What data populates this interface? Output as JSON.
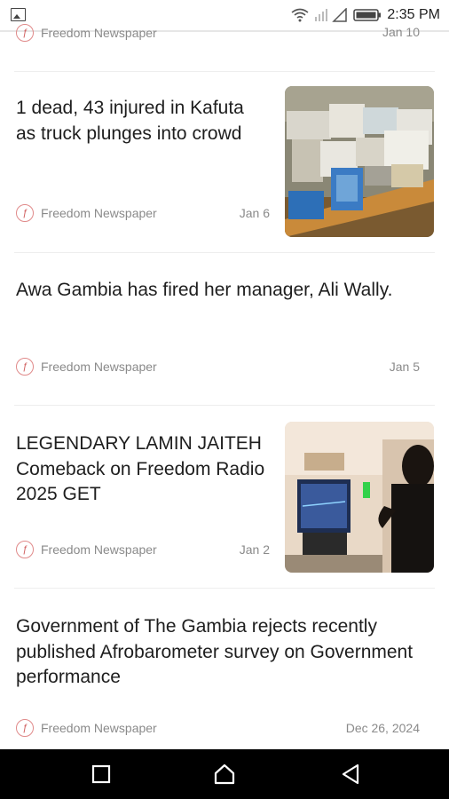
{
  "status_bar": {
    "time": "2:35 PM"
  },
  "articles": [
    {
      "title": "",
      "source": "Freedom Newspaper",
      "date": "Jan 10"
    },
    {
      "title": "1 dead, 43 injured in Kafuta as truck plunges into crowd",
      "source": "Freedom Newspaper",
      "date": "Jan 6",
      "thumbnail": "boxes-on-table-image"
    },
    {
      "title": "Awa Gambia has fired her manager, Ali Wally.",
      "source": "Freedom Newspaper",
      "date": "Jan 5"
    },
    {
      "title": "LEGENDARY LAMIN JAITEH  Comeback on Freedom Radio 2025 GET",
      "source": "Freedom Newspaper",
      "date": "Jan 2",
      "thumbnail": "radio-studio-image"
    },
    {
      "title": "Government of The Gambia rejects recently published Afrobarometer survey on Government performance",
      "source": "Freedom Newspaper",
      "date": "Dec 26, 2024"
    }
  ],
  "colors": {
    "source_logo": "#d06060",
    "navbar": "#000000"
  },
  "icons": {
    "status": [
      "gallery-icon",
      "wifi-icon",
      "signal-icon",
      "battery-icon"
    ],
    "nav": [
      "recent-apps-icon",
      "home-icon",
      "back-icon"
    ]
  }
}
